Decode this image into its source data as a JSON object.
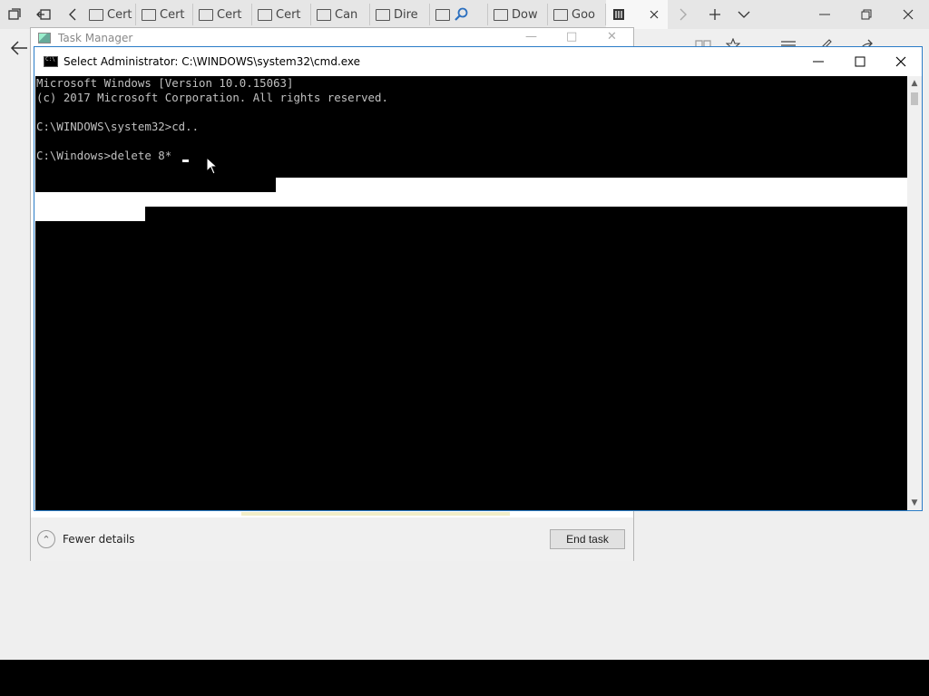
{
  "browser": {
    "tabs": [
      {
        "label": "Cert"
      },
      {
        "label": "Cert"
      },
      {
        "label": "Cert"
      },
      {
        "label": "Cert"
      },
      {
        "label": "Can"
      },
      {
        "label": "Dire"
      },
      {
        "label": ""
      },
      {
        "label": "Dow"
      },
      {
        "label": "Goo"
      },
      {
        "label": ""
      }
    ]
  },
  "task_manager": {
    "title": "Task Manager",
    "fewer_details_label": "Fewer details",
    "end_task_label": "End task"
  },
  "cmd": {
    "title": "Select Administrator: C:\\WINDOWS\\system32\\cmd.exe",
    "lines": [
      "Microsoft Windows [Version 10.0.15063]",
      "(c) 2017 Microsoft Corporation. All rights reserved.",
      "",
      "C:\\WINDOWS\\system32>cd..",
      "",
      "C:\\Windows>delete 8*"
    ]
  }
}
